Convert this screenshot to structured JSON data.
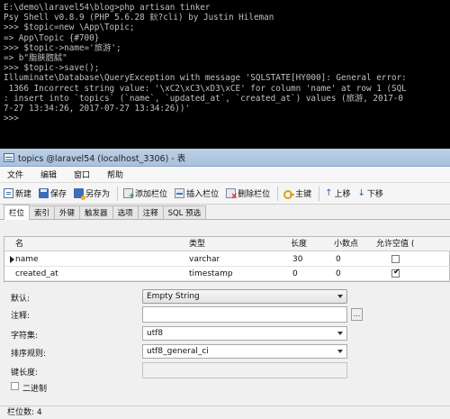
{
  "terminal": {
    "lines": [
      "E:\\demo\\laravel54\\blog>php artisan tinker",
      "Psy Shell v0.8.9 (PHP 5.6.28 鈥?cli) by Justin Hileman",
      ">>> $topic=new \\App\\Topic;",
      "=> App\\Topic {#700}",
      ">>> $topic->name='旅游';",
      "=> b\"脂脥脗脦\"",
      ">>> $topic->save();",
      "Illuminate\\Database\\QueryException with message 'SQLSTATE[HY000]: General error:",
      " 1366 Incorrect string value: '\\xC2\\xC3\\xD3\\xCE' for column 'name' at row 1 (SQL",
      ": insert into `topics` (`name`, `updated_at`, `created_at`) values (旅游, 2017-0",
      "7-27 13:34:26, 2017-07-27 13:34:26))'",
      ">>> "
    ]
  },
  "window": {
    "title": "topics @laravel54 (localhost_3306) - 表"
  },
  "menu": {
    "items": [
      "文件",
      "编辑",
      "窗口",
      "帮助"
    ]
  },
  "toolbar": {
    "new_label": "新建",
    "save_label": "保存",
    "save_as_label": "另存为",
    "add_field_label": "添加栏位",
    "insert_field_label": "插入栏位",
    "delete_field_label": "删除栏位",
    "primary_key_label": "主键",
    "move_up_label": "上移",
    "move_down_label": "下移"
  },
  "tabs": [
    "栏位",
    "索引",
    "外键",
    "触发器",
    "选项",
    "注释",
    "SQL 预选"
  ],
  "fields": {
    "columns": [
      "名",
      "类型",
      "长度",
      "小数点",
      "允许空值 ("
    ],
    "rows": [
      {
        "name": "name",
        "type": "varchar",
        "length": "30",
        "decimals": "0",
        "nullable": false
      },
      {
        "name": "created_at",
        "type": "timestamp",
        "length": "0",
        "decimals": "0",
        "nullable": true
      }
    ]
  },
  "properties": {
    "default_label": "默认:",
    "default_value": "Empty String",
    "comment_label": "注释:",
    "comment_button": "...",
    "charset_label": "字符集:",
    "charset_value": "utf8",
    "collation_label": "排序规则:",
    "collation_value": "utf8_general_ci",
    "key_length_label": "键长度:",
    "binary_label": "二进制"
  },
  "status": {
    "field_count": "栏位数: 4"
  },
  "colors": {
    "terminal_bg": "#000000",
    "terminal_fg": "#c0c0c0",
    "titlebar": "#bcd0e6"
  }
}
